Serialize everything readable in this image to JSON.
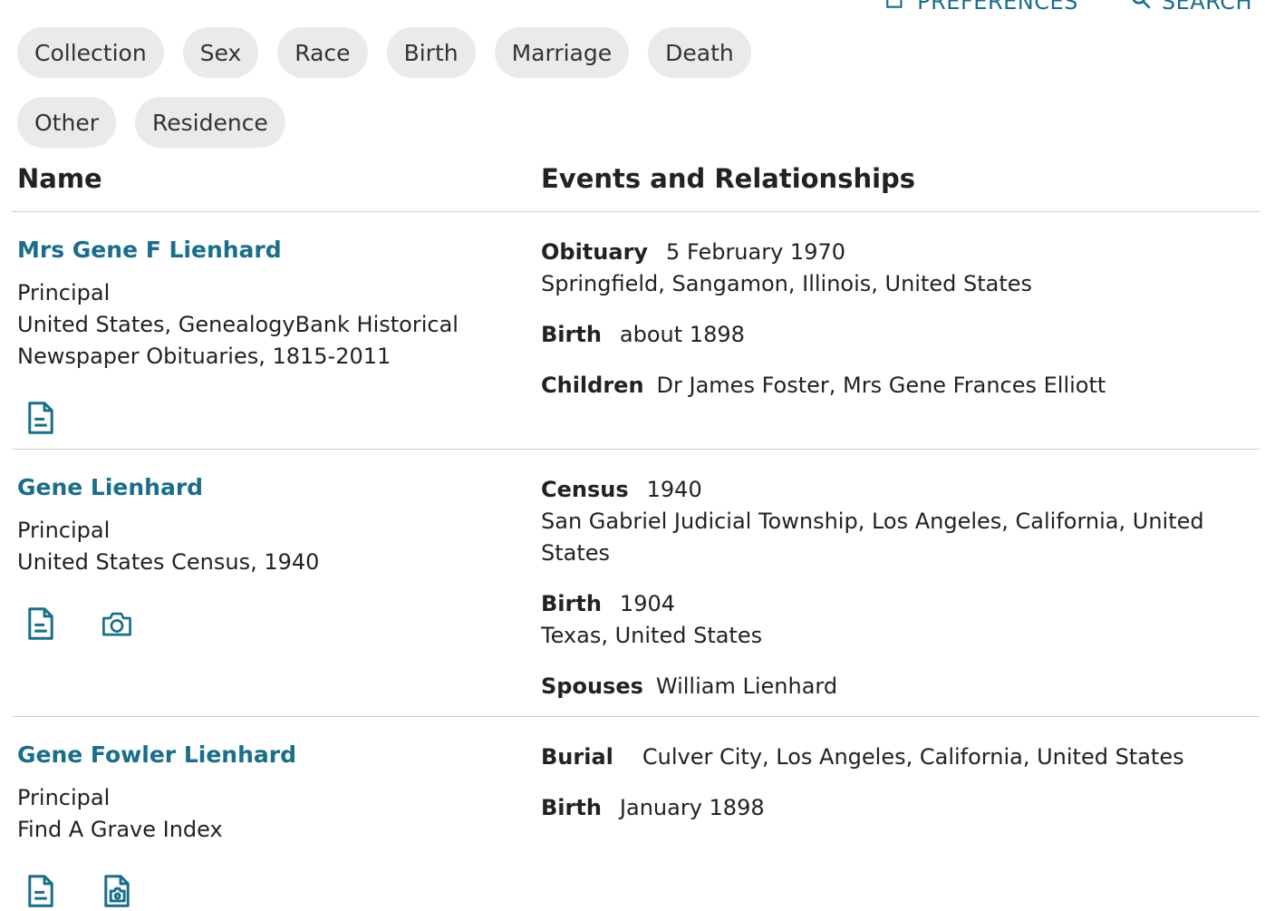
{
  "top_links": [
    {
      "label": "PREFERENCES",
      "icon": "preferences-icon"
    },
    {
      "label": "SEARCH",
      "icon": "search-icon"
    }
  ],
  "filter_chips": [
    "Collection",
    "Sex",
    "Race",
    "Birth",
    "Marriage",
    "Death",
    "Other",
    "Residence"
  ],
  "columns": {
    "name": "Name",
    "events": "Events and Relationships"
  },
  "colors": {
    "accent": "#1a6e8a",
    "chip_bg": "#e9eaea",
    "rule": "#cfcfcf"
  },
  "results": [
    {
      "name": "Mrs Gene F Lienhard",
      "role": "Principal",
      "collection": "United States, GenealogyBank Historical Newspaper Obituaries, 1815-2011",
      "icons": [
        "document-icon"
      ],
      "events": [
        {
          "label": "Obituary",
          "value": "5 February 1970",
          "place": "Springfield, Sangamon, Illinois, United States"
        },
        {
          "label": "Birth",
          "value": "about 1898",
          "place": ""
        },
        {
          "label": "Children",
          "value": "Dr James Foster, Mrs Gene Frances Elliott",
          "place": ""
        }
      ]
    },
    {
      "name": "Gene Lienhard",
      "role": "Principal",
      "collection": "United States Census, 1940",
      "icons": [
        "document-icon",
        "camera-icon"
      ],
      "events": [
        {
          "label": "Census",
          "value": "1940",
          "place": "San Gabriel Judicial Township, Los Angeles, California, United States"
        },
        {
          "label": "Birth",
          "value": "1904",
          "place": "Texas, United States"
        },
        {
          "label": "Spouses",
          "value": "William Lienhard",
          "place": ""
        }
      ]
    },
    {
      "name": "Gene Fowler Lienhard",
      "role": "Principal",
      "collection": "Find A Grave Index",
      "icons": [
        "document-icon",
        "photo-document-icon"
      ],
      "events": [
        {
          "label": "Burial",
          "value": "Culver City, Los Angeles, California, United States",
          "place": ""
        },
        {
          "label": "Birth",
          "value": "January 1898",
          "place": ""
        }
      ]
    }
  ]
}
